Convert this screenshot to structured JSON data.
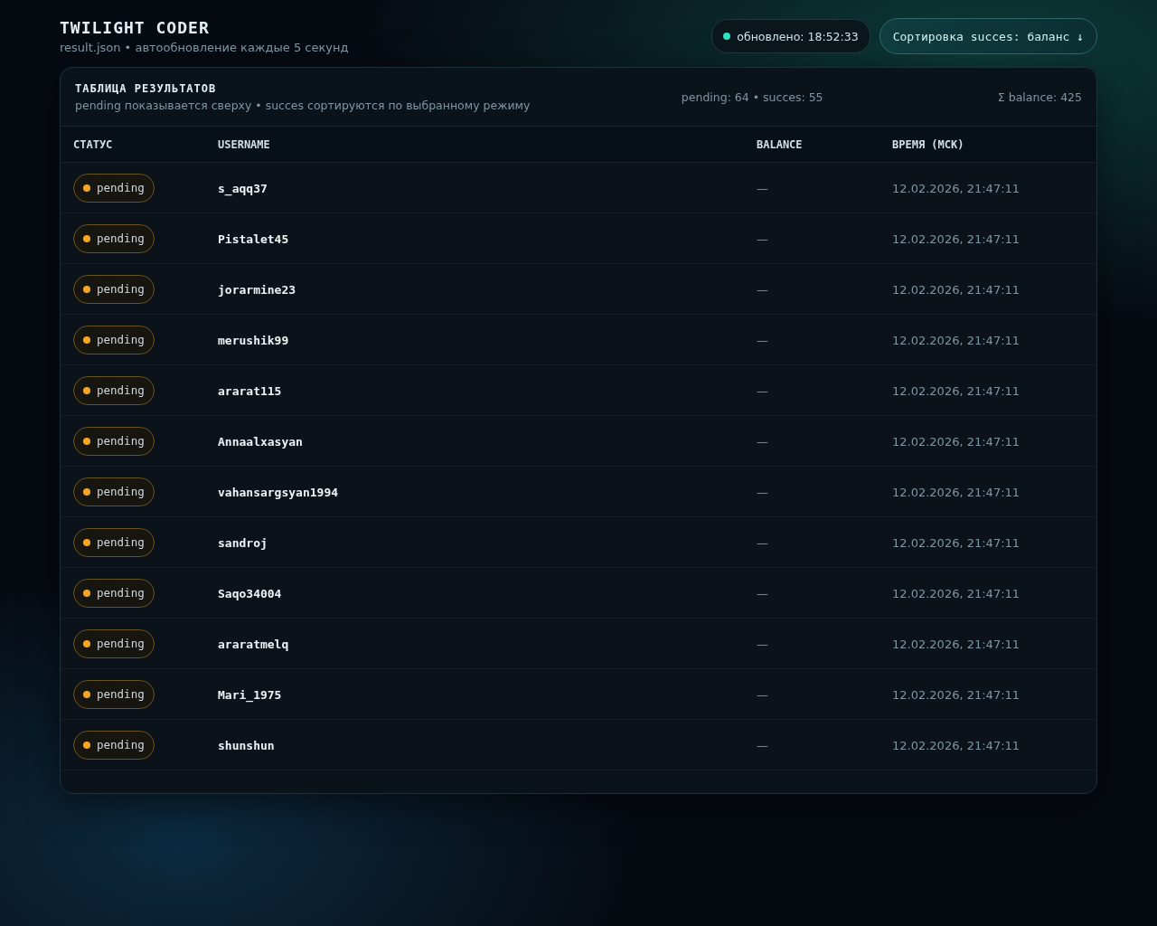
{
  "header": {
    "title": "TWILIGHT CODER",
    "subtitle": "result.json • автообновление каждые 5 секунд",
    "updated": "обновлено: 18:52:33",
    "sort_button": "Сортировка succes: баланс ↓"
  },
  "card": {
    "title": "ТАБЛИЦА РЕЗУЛЬТАТОВ",
    "subtitle": "pending показывается сверху • succes сортируются по выбранному режиму",
    "counts": "pending: 64 • succes: 55",
    "total": "Σ balance: 425"
  },
  "table": {
    "columns": [
      "СТАТУС",
      "USERNAME",
      "BALANCE",
      "ВРЕМЯ (МСК)"
    ],
    "rows": [
      {
        "status": "pending",
        "kind": "pending",
        "username": "s_aqq37",
        "balance": "—",
        "time": "12.02.2026, 21:47:11"
      },
      {
        "status": "pending",
        "kind": "pending",
        "username": "Pistalet45",
        "balance": "—",
        "time": "12.02.2026, 21:47:11"
      },
      {
        "status": "pending",
        "kind": "pending",
        "username": "jorarmine23",
        "balance": "—",
        "time": "12.02.2026, 21:47:11"
      },
      {
        "status": "pending",
        "kind": "pending",
        "username": "merushik99",
        "balance": "—",
        "time": "12.02.2026, 21:47:11"
      },
      {
        "status": "pending",
        "kind": "pending",
        "username": "ararat115",
        "balance": "—",
        "time": "12.02.2026, 21:47:11"
      },
      {
        "status": "pending",
        "kind": "pending",
        "username": "Annaalxasyan",
        "balance": "—",
        "time": "12.02.2026, 21:47:11"
      },
      {
        "status": "pending",
        "kind": "pending",
        "username": "vahansargsyan1994",
        "balance": "—",
        "time": "12.02.2026, 21:47:11"
      },
      {
        "status": "pending",
        "kind": "pending",
        "username": "sandroj",
        "balance": "—",
        "time": "12.02.2026, 21:47:11"
      },
      {
        "status": "pending",
        "kind": "pending",
        "username": "Saqo34004",
        "balance": "—",
        "time": "12.02.2026, 21:47:11"
      },
      {
        "status": "pending",
        "kind": "pending",
        "username": "araratmelq",
        "balance": "—",
        "time": "12.02.2026, 21:47:11"
      },
      {
        "status": "pending",
        "kind": "pending",
        "username": "Mari_1975",
        "balance": "—",
        "time": "12.02.2026, 21:47:11"
      },
      {
        "status": "pending",
        "kind": "pending",
        "username": "shunshun",
        "balance": "—",
        "time": "12.02.2026, 21:47:11"
      }
    ]
  }
}
